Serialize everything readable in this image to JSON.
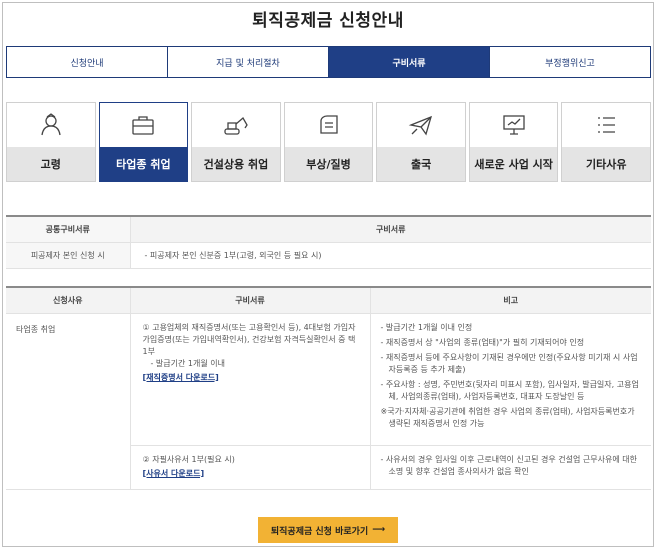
{
  "title": "퇴직공제금 신청안내",
  "tabs": [
    {
      "label": "신청안내",
      "active": false
    },
    {
      "label": "지급 및 처리절차",
      "active": false
    },
    {
      "label": "구비서류",
      "active": true
    },
    {
      "label": "부정행위신고",
      "active": false
    }
  ],
  "categories": [
    {
      "label": "고령",
      "icon": "elderly-icon",
      "active": false
    },
    {
      "label": "타업종 취업",
      "icon": "briefcase-icon",
      "active": true
    },
    {
      "label": "건설상용 취업",
      "icon": "excavator-icon",
      "active": false
    },
    {
      "label": "부상/질병",
      "icon": "bandage-icon",
      "active": false
    },
    {
      "label": "출국",
      "icon": "airplane-icon",
      "active": false
    },
    {
      "label": "새로운 사업 시작",
      "icon": "presentation-icon",
      "active": false
    },
    {
      "label": "기타사유",
      "icon": "list-icon",
      "active": false
    }
  ],
  "common_table": {
    "headers": [
      "공통구비서류",
      "구비서류"
    ],
    "row": {
      "label": "피공제자 본인 신청 시",
      "value": "- 피공제자 본인 신분증 1부(고령, 외국인 등 필요 시)"
    }
  },
  "reason_table": {
    "headers": [
      "신청사유",
      "구비서류",
      "비고"
    ],
    "reason": "타업종 취업",
    "row1": {
      "docs": "① 고용업체의 재직증명서(또는 고용확인서 등), 4대보험 가입자 가입증명(또는 가입내역확인서), 건강보험 자격득실확인서 중 택 1부",
      "docs_sub": "- 발급기간 1개월 이내",
      "download": "[재직증명서 다운로드]",
      "notes": [
        "- 발급기간 1개월 이내 인정",
        "- 재직증명서 상 \"사업의 종류(업태)\"가 필히 기재되어야 인정",
        "- 재직증명서 등에 주요사항이 기재된 경우에만 인정(주요사항 미기재 시 사업자등록증 등 추가 제출)",
        "- 주요사항 : 성명, 주민번호(뒷자리 미표시 포함), 입사일자, 발급일자, 고용업체, 사업의종류(업태), 사업자등록번호, 대표자 도장날인 등",
        "※국가·지자체·공공기관에 취업한 경우 사업의 종류(업태), 사업자등록번호가 생략된 재직증명서 인정 가능"
      ]
    },
    "row2": {
      "docs": "② 자필사유서 1부(필요 시)",
      "download": "[사유서 다운로드]",
      "notes": [
        "- 사유서의 경우 입사일 이후 근로내역이 신고된 경우 건설업 근무사유에 대한 소명 및 향후 건설업 종사의사가 없음 확인"
      ]
    }
  },
  "cta": {
    "label": "퇴직공제금 신청 바로가기",
    "arrow": "⟶"
  }
}
